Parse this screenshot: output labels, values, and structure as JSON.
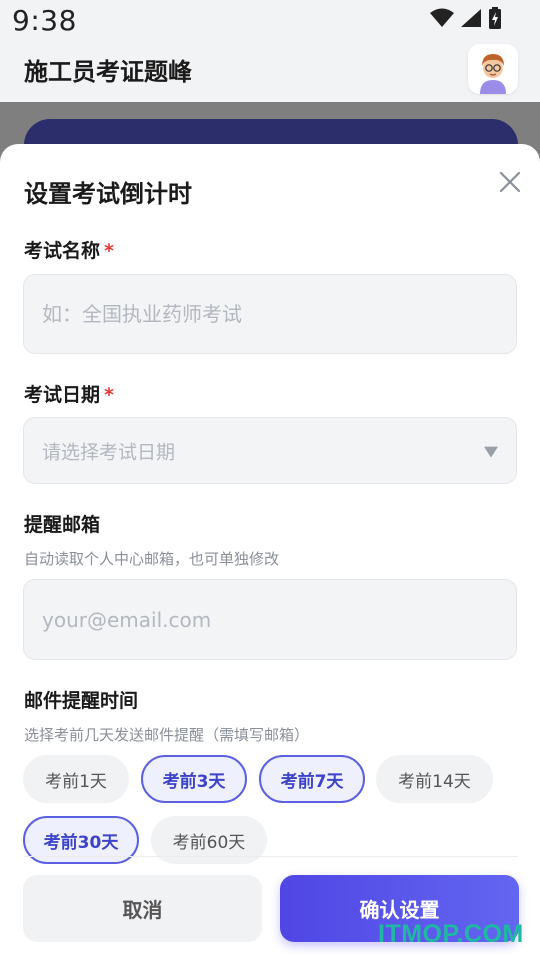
{
  "status": {
    "time": "9:38"
  },
  "app": {
    "title": "施工员考证题峰"
  },
  "sheet": {
    "title": "设置考试倒计时",
    "exam_name": {
      "label": "考试名称",
      "required": "*",
      "placeholder": "如：全国执业药师考试",
      "value": ""
    },
    "exam_date": {
      "label": "考试日期",
      "required": "*",
      "placeholder": "请选择考试日期"
    },
    "email": {
      "label": "提醒邮箱",
      "hint": "自动读取个人中心邮箱，也可单独修改",
      "placeholder": "your@email.com",
      "value": ""
    },
    "reminder": {
      "label": "邮件提醒时间",
      "hint": "选择考前几天发送邮件提醒（需填写邮箱）",
      "options": [
        {
          "label": "考前1天",
          "selected": false
        },
        {
          "label": "考前3天",
          "selected": true
        },
        {
          "label": "考前7天",
          "selected": true
        },
        {
          "label": "考前14天",
          "selected": false
        },
        {
          "label": "考前30天",
          "selected": true
        },
        {
          "label": "考前60天",
          "selected": false
        }
      ]
    },
    "buttons": {
      "cancel": "取消",
      "confirm": "确认设置"
    }
  },
  "watermark": "ITMOP.COM",
  "colors": {
    "accent": "#5b5fe0",
    "required": "#e53935",
    "overlay": "#7f7f80"
  }
}
